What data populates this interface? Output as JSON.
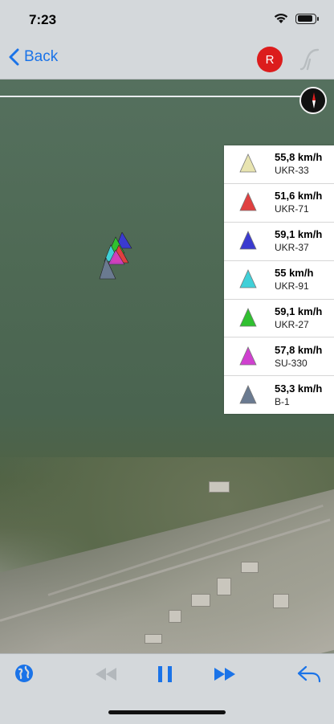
{
  "status_bar": {
    "time": "7:23"
  },
  "nav": {
    "back_label": "Back",
    "record_label": "R"
  },
  "legend": [
    {
      "speed": "55,8 km/h",
      "name": "UKR-33",
      "color": "#e8e4b0"
    },
    {
      "speed": "51,6 km/h",
      "name": "UKR-71",
      "color": "#e04040"
    },
    {
      "speed": "59,1 km/h",
      "name": "UKR-37",
      "color": "#3a3ad0"
    },
    {
      "speed": "55 km/h",
      "name": "UKR-91",
      "color": "#40d0d8"
    },
    {
      "speed": "59,1 km/h",
      "name": "UKR-27",
      "color": "#30c030"
    },
    {
      "speed": "57,8 km/h",
      "name": "SU-330",
      "color": "#d040d0"
    },
    {
      "speed": "53,3 km/h",
      "name": "B-1",
      "color": "#6a7a90"
    }
  ],
  "toolbar": {
    "icons": [
      "globe-icon",
      "rewind-icon",
      "pause-icon",
      "fast-forward-icon",
      "reply-icon"
    ],
    "accent": "#1a73e8"
  }
}
